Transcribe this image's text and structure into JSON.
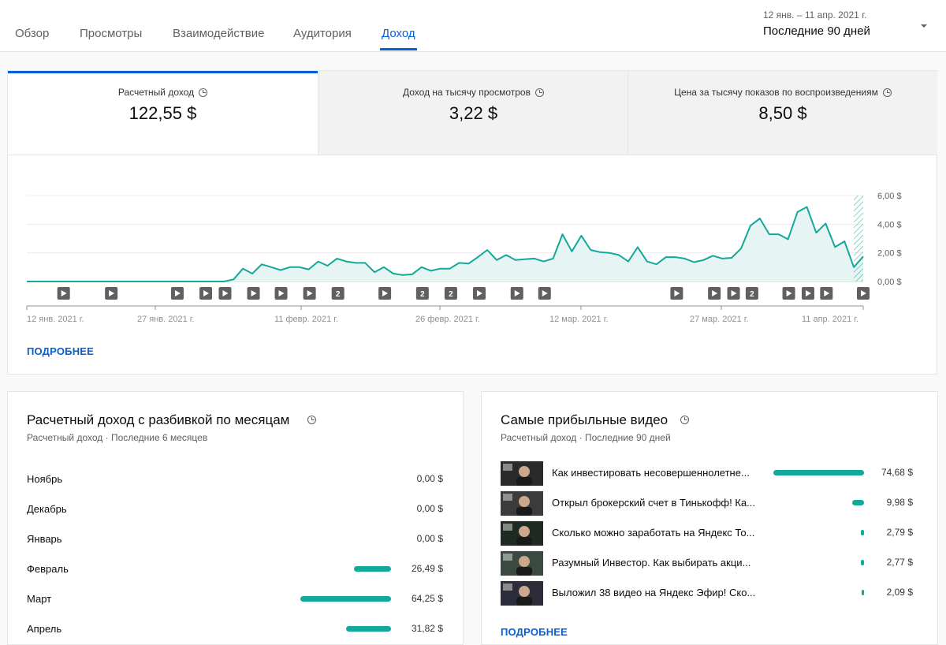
{
  "tabs": [
    {
      "label": "Обзор",
      "active": false
    },
    {
      "label": "Просмотры",
      "active": false
    },
    {
      "label": "Взаимодействие",
      "active": false
    },
    {
      "label": "Аудитория",
      "active": false
    },
    {
      "label": "Доход",
      "active": true
    }
  ],
  "period_selector": {
    "range": "12 янв. – 11 апр. 2021 г.",
    "label": "Последние 90 дней"
  },
  "metrics": [
    {
      "label": "Расчетный доход",
      "value": "122,55 $"
    },
    {
      "label": "Доход на тысячу просмотров",
      "value": "3,22 $"
    },
    {
      "label": "Цена за тысячу показов по воспроизведениям",
      "value": "8,50 $"
    }
  ],
  "chart_data": {
    "type": "area",
    "ylim": [
      0,
      6
    ],
    "y_ticks": [
      "6,00 $",
      "4,00 $",
      "2,00 $",
      "0,00 $"
    ],
    "x_labels": [
      "12 янв. 2021 г.",
      "27 янв. 2021 г.",
      "11 февр. 2021 г.",
      "26 февр. 2021 г.",
      "12 мар. 2021 г.",
      "27 мар. 2021 г.",
      "11 апр. 2021 г."
    ],
    "series": [
      {
        "values": [
          0,
          0,
          0,
          0,
          0,
          0,
          0,
          0,
          0,
          0,
          0,
          0,
          0,
          0,
          0,
          0,
          0,
          0,
          0,
          0,
          0,
          0,
          0.15,
          0.9,
          0.55,
          1.2,
          1.0,
          0.8,
          1.0,
          1.0,
          0.85,
          1.4,
          1.1,
          1.6,
          1.4,
          1.3,
          1.3,
          0.65,
          1.0,
          0.55,
          0.45,
          0.5,
          1.0,
          0.75,
          0.9,
          0.9,
          1.3,
          1.25,
          1.7,
          2.2,
          1.5,
          1.85,
          1.5,
          1.55,
          1.6,
          1.4,
          1.6,
          3.3,
          2.1,
          3.2,
          2.2,
          2.05,
          2.0,
          1.85,
          1.4,
          2.4,
          1.4,
          1.2,
          1.7,
          1.7,
          1.6,
          1.35,
          1.5,
          1.8,
          1.6,
          1.65,
          2.3,
          3.9,
          4.4,
          3.3,
          3.3,
          2.95,
          4.85,
          5.2,
          3.4,
          4.05,
          2.4,
          2.8,
          1.0,
          1.75
        ]
      }
    ],
    "markers": [
      "play",
      "play",
      "play",
      "play",
      "play",
      "play",
      "play",
      "2",
      "play",
      "2",
      "2",
      "play",
      "play",
      "play",
      "play",
      "play",
      "2",
      "play",
      "play",
      "play"
    ]
  },
  "more_label": "ПОДРОБНЕЕ",
  "monthly": {
    "title": "Расчетный доход с разбивкой по месяцам",
    "subtitle": "Расчетный доход · Последние 6 месяцев",
    "rows": [
      {
        "label": "Ноябрь",
        "value": "0,00 $",
        "amount": 0
      },
      {
        "label": "Декабрь",
        "value": "0,00 $",
        "amount": 0
      },
      {
        "label": "Январь",
        "value": "0,00 $",
        "amount": 0
      },
      {
        "label": "Февраль",
        "value": "26,49 $",
        "amount": 26.49
      },
      {
        "label": "Март",
        "value": "64,25 $",
        "amount": 64.25
      },
      {
        "label": "Апрель",
        "value": "31,82 $",
        "amount": 31.82
      }
    ]
  },
  "top_videos": {
    "title": "Самые прибыльные видео",
    "subtitle": "Расчетный доход · Последние 90 дней",
    "rows": [
      {
        "title": "Как инвестировать несовершеннолетне...",
        "value": "74,68 $",
        "amount": 74.68,
        "thumb": "#2a2a2a"
      },
      {
        "title": "Открыл брокерский счет в Тинькофф! Ка...",
        "value": "9,98 $",
        "amount": 9.98,
        "thumb": "#3b3b3b"
      },
      {
        "title": "Сколько можно заработать на Яндекс То...",
        "value": "2,79 $",
        "amount": 2.79,
        "thumb": "#1e2a22"
      },
      {
        "title": "Разумный Инвестор. Как выбирать акци...",
        "value": "2,77 $",
        "amount": 2.77,
        "thumb": "#3a4a40"
      },
      {
        "title": "Выложил 38 видео на Яндекс Эфир! Ско...",
        "value": "2,09 $",
        "amount": 2.09,
        "thumb": "#2c2c3a"
      }
    ]
  },
  "colors": {
    "accent": "#065fd4",
    "series": "#12a89a",
    "fill": "#e6f5f3"
  }
}
